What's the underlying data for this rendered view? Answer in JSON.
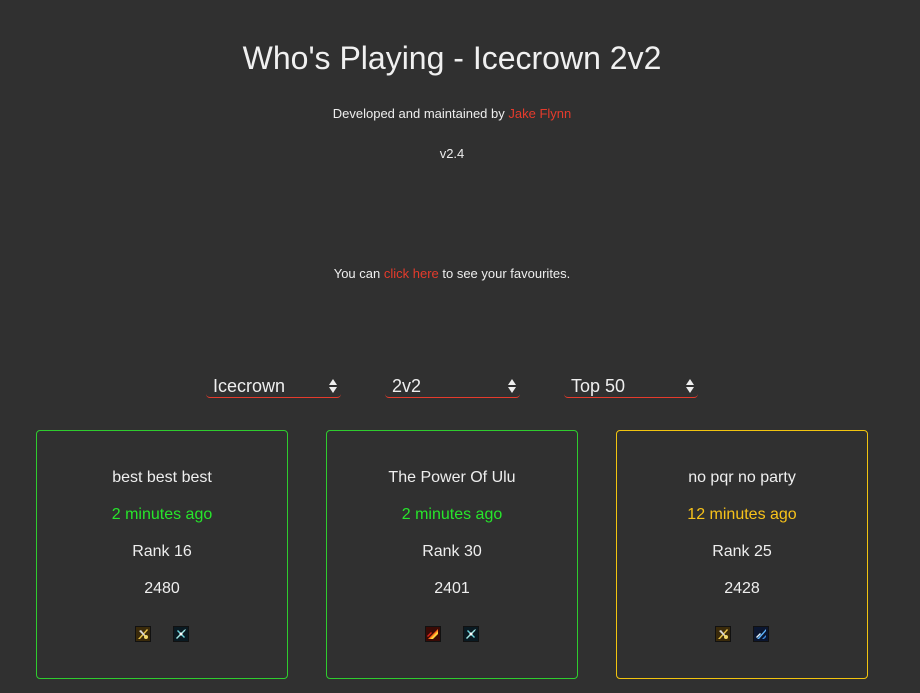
{
  "header": {
    "title": "Who's Playing - Icecrown 2v2",
    "credit_prefix": "Developed and maintained by ",
    "author": "Jake Flynn",
    "version": "v2.4"
  },
  "favourites": {
    "prefix": "You can ",
    "link": "click here",
    "suffix": " to see your favourites."
  },
  "filters": {
    "realm": "Icecrown",
    "bracket": "2v2",
    "range": "Top 50"
  },
  "colors": {
    "background": "#303030",
    "link": "#e53b2c",
    "recent": "#27e52b",
    "older": "#f7c21a"
  },
  "cards": [
    {
      "team": "best best best",
      "last_seen": "2 minutes ago",
      "rank": "Rank 16",
      "rating": "2480",
      "status": "green",
      "icons": [
        "class-spec-icon-warrior",
        "class-spec-icon-rogue"
      ]
    },
    {
      "team": "The Power Of Ulu",
      "last_seen": "2 minutes ago",
      "rank": "Rank 30",
      "rating": "2401",
      "status": "green",
      "icons": [
        "class-spec-icon-fire",
        "class-spec-icon-rogue"
      ]
    },
    {
      "team": "no pqr no party",
      "last_seen": "12 minutes ago",
      "rank": "Rank 25",
      "rating": "2428",
      "status": "yellow",
      "icons": [
        "class-spec-icon-warrior",
        "class-spec-icon-shaman"
      ]
    }
  ]
}
